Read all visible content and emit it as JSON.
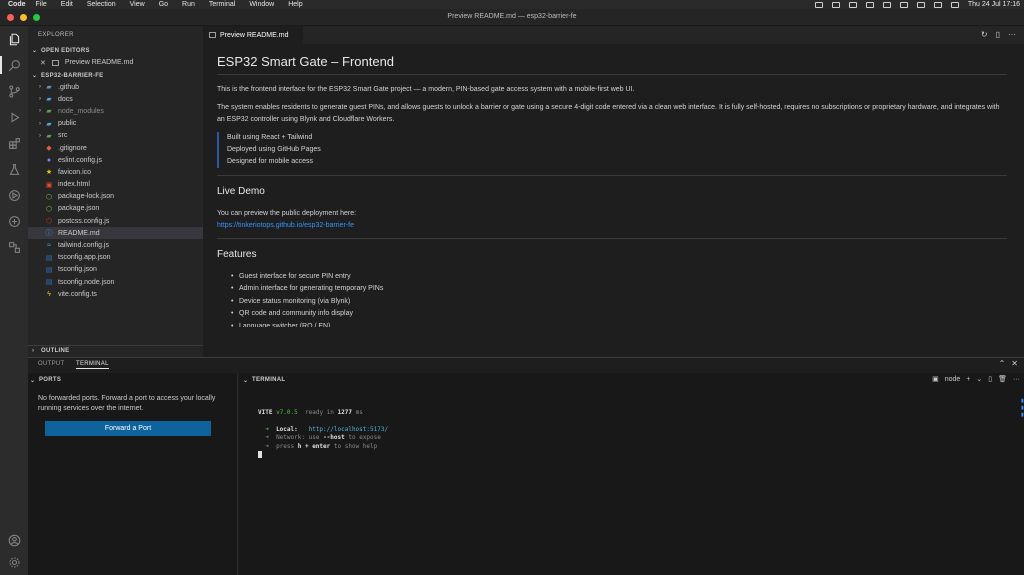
{
  "menubar": {
    "app": "Code",
    "items": [
      "File",
      "Edit",
      "Selection",
      "View",
      "Go",
      "Run",
      "Terminal",
      "Window",
      "Help"
    ],
    "clock": "Thu 24 Jul  17:16"
  },
  "window": {
    "title": "Preview README.md — esp32-barrier-fe"
  },
  "sidebar": {
    "title": "EXPLORER",
    "open_editors": {
      "label": "OPEN EDITORS",
      "item": "Preview README.md"
    },
    "project": {
      "label": "ESP32-BARRIER-FE"
    },
    "tree": [
      {
        "name": ".github",
        "type": "folder"
      },
      {
        "name": "docs",
        "type": "folder"
      },
      {
        "name": "node_modules",
        "type": "folder"
      },
      {
        "name": "public",
        "type": "folder"
      },
      {
        "name": "src",
        "type": "folder"
      },
      {
        "name": ".gitignore",
        "type": "file"
      },
      {
        "name": "eslint.config.js",
        "type": "file"
      },
      {
        "name": "favicon.ico",
        "type": "file"
      },
      {
        "name": "index.html",
        "type": "file"
      },
      {
        "name": "package-lock.json",
        "type": "file"
      },
      {
        "name": "package.json",
        "type": "file"
      },
      {
        "name": "postcss.config.js",
        "type": "file"
      },
      {
        "name": "README.md",
        "type": "file"
      },
      {
        "name": "tailwind.config.js",
        "type": "file"
      },
      {
        "name": "tsconfig.app.json",
        "type": "file"
      },
      {
        "name": "tsconfig.json",
        "type": "file"
      },
      {
        "name": "tsconfig.node.json",
        "type": "file"
      },
      {
        "name": "vite.config.ts",
        "type": "file"
      }
    ],
    "outline_label": "OUTLINE"
  },
  "editor": {
    "tab_label": "Preview README.md",
    "preview": {
      "h1": "ESP32 Smart Gate – Frontend",
      "p1": "This is the frontend interface for the ESP32 Smart Gate project — a modern, PIN-based gate access system with a mobile-first web UI.",
      "p2": "The system enables residents to generate guest PINs, and allows guests to unlock a barrier or gate using a secure 4-digit code entered via a clean web interface. It is fully self-hosted, requires no subscriptions or proprietary hardware, and integrates with an ESP32 controller using Blynk and Cloudflare Workers.",
      "quote": [
        "Built using React + Tailwind",
        "Deployed using GitHub Pages",
        "Designed for mobile access"
      ],
      "h2_demo": "Live Demo",
      "demo_text": "You can preview the public deployment here:",
      "demo_link": "https://tinkeriotops.github.io/esp32-barrier-fe",
      "h2_features": "Features",
      "features": [
        "Guest interface for secure PIN entry",
        "Admin interface for generating temporary PINs",
        "Device status monitoring (via Blynk)",
        "QR code and community info display",
        "Language switcher (RO / EN)"
      ]
    }
  },
  "panel": {
    "tabs": [
      "OUTPUT",
      "TERMINAL"
    ],
    "ports": {
      "label": "PORTS",
      "message": "No forwarded ports. Forward a port to access your locally running services over the internet.",
      "button": "Forward a Port"
    },
    "terminal": {
      "label": "TERMINAL",
      "shell": "node",
      "vite_name": "VITE",
      "vite_version": "v7.0.5",
      "ready_text": "ready in",
      "ready_ms": "1277",
      "ms_unit": "ms",
      "local_label": "Local:",
      "local_url": "http://localhost:5173/",
      "network_label": "Network:",
      "network_text": "use",
      "host_flag": "--host",
      "expose_text": "to expose",
      "help_press": "press",
      "help_key": "h + enter",
      "help_rest": "to show help"
    }
  }
}
